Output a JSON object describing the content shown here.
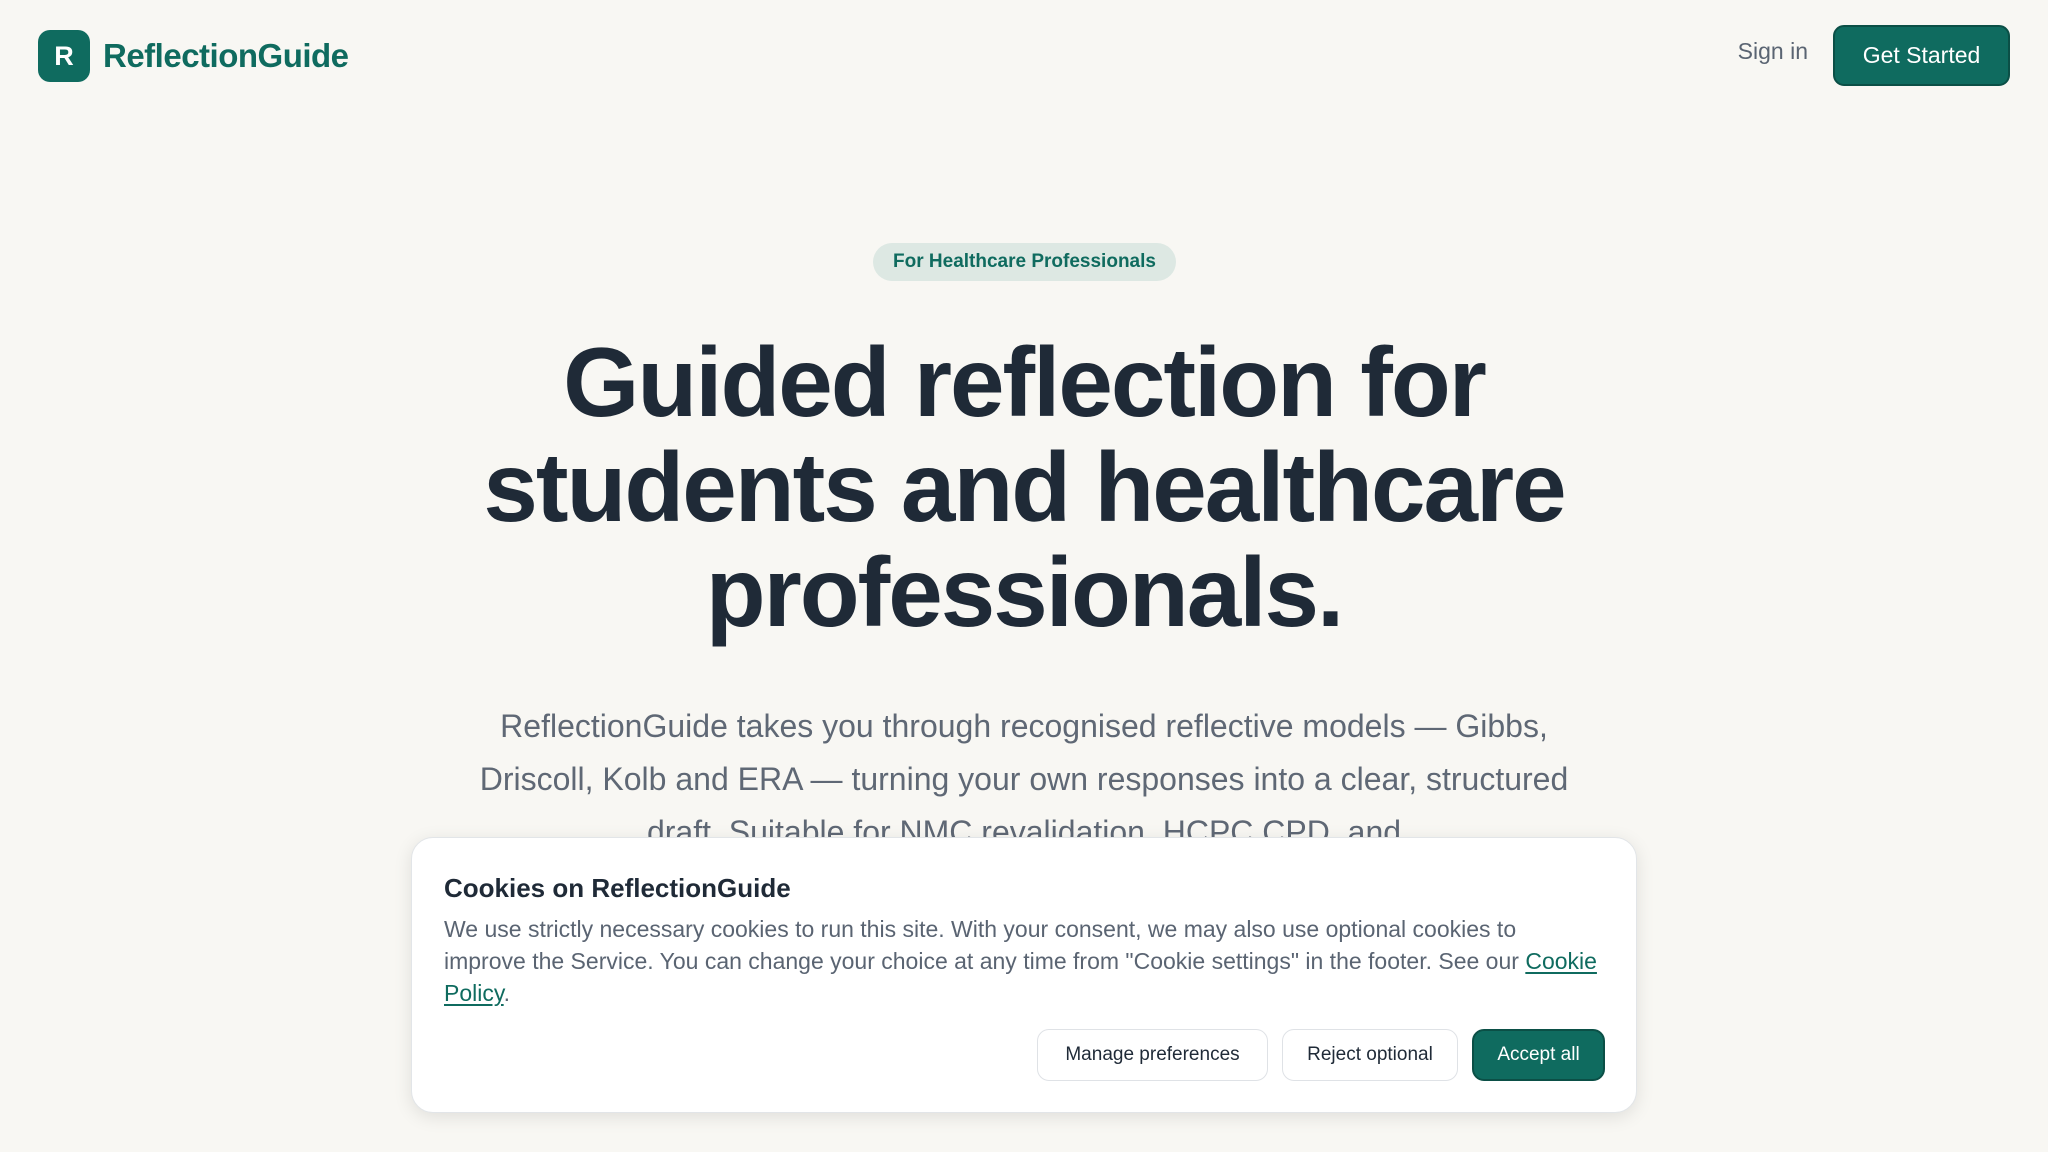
{
  "header": {
    "logo_letter": "R",
    "brand": "ReflectionGuide",
    "sign_in": "Sign in",
    "get_started": "Get Started"
  },
  "hero": {
    "badge": "For Healthcare Professionals",
    "title": "Guided reflection for students and healthcare professionals.",
    "subtitle": "ReflectionGuide takes you through recognised reflective models — Gibbs, Driscoll, Kolb and ERA — turning your own responses into a clear, structured draft. Suitable for NMC revalidation, HCPC CPD, and"
  },
  "cookie_banner": {
    "title": "Cookies on ReflectionGuide",
    "text": "We use strictly necessary cookies to run this site. With your consent, we may also use optional cookies to improve the Service. You can change your choice at any time from \"Cookie settings\" in the footer. See our ",
    "link": "Cookie Policy",
    "text_end": ".",
    "manage": "Manage preferences",
    "reject": "Reject optional",
    "accept": "Accept all"
  },
  "colors": {
    "brand": "#0f6b5f",
    "background": "#f8f7f3",
    "heading": "#1f2a37",
    "body_text": "#5f6875"
  }
}
